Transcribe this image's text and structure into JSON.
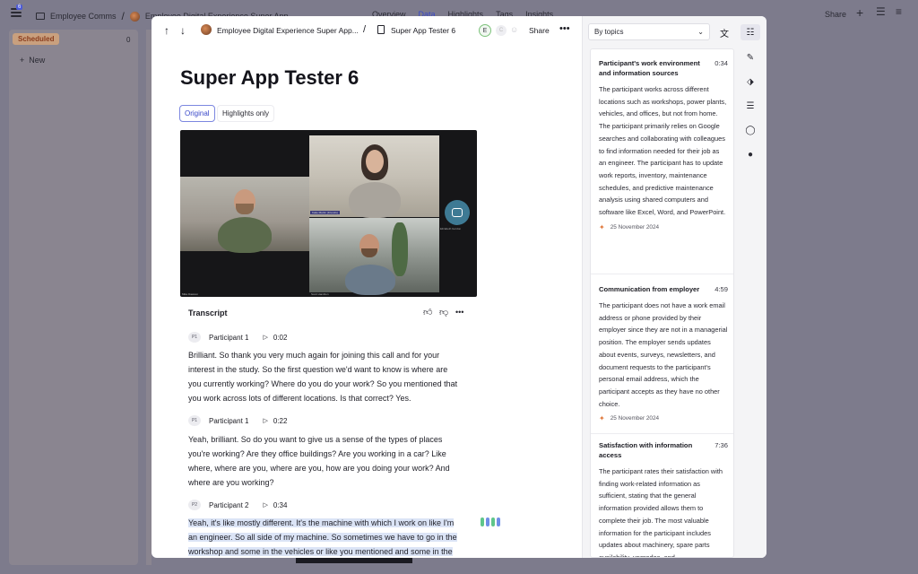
{
  "background": {
    "notification_count": "6",
    "breadcrumb_workspace": "Employee Comms",
    "breadcrumb_project": "Employee Digital Experience Super App",
    "nav": [
      "Overview",
      "Data",
      "Highlights",
      "Tags",
      "Insights"
    ],
    "share_label": "Share",
    "column_label": "Scheduled",
    "column_count": "0",
    "new_label": "New"
  },
  "modal": {
    "breadcrumb_project": "Employee Digital Experience Super App...",
    "breadcrumb_doc": "Super App Tester 6",
    "avatar_initial": "E",
    "avatar_initial_2": "C",
    "share_label": "Share",
    "title": "Super App Tester 6",
    "toggle_original": "Original",
    "toggle_highlights": "Highlights only",
    "transcript_title": "Transcript",
    "video_names": [
      "Mike Dawson",
      "Katie Martin (Friends)",
      "Scott Hamilton",
      "Elizabeth Gordon"
    ],
    "entries": [
      {
        "badge": "P1",
        "speaker": "Participant 1",
        "time": "0:02",
        "lines": [
          "Brilliant. So thank you very much again for joining this call and for your",
          "interest in the study. So the first question we'd want to know is where are",
          "you currently working? Where do you do your work? So you mentioned that",
          "you work across lots of different locations. Is that correct? Yes."
        ]
      },
      {
        "badge": "P1",
        "speaker": "Participant 1",
        "time": "0:22",
        "lines": [
          "Yeah, brilliant. So do you want to give us a sense of the types of places",
          "you're working? Are they office buildings? Are you working in a car? Like",
          "where, where are you, where are you, how are you doing your work? And",
          "where are you working?"
        ]
      },
      {
        "badge": "P2",
        "speaker": "Participant 2",
        "time": "0:34",
        "lines": [
          "Yeah, it's like mostly different. It's the machine with which I work on like I'm",
          "an engineer. So all side of my machine. So sometimes we have to go in the",
          "workshop and some in the vehicles or like you mentioned and some in the"
        ]
      }
    ],
    "highlight_colors": [
      "#5fc58a",
      "#6f8ee6",
      "#5fc58a",
      "#6f8ee6"
    ]
  },
  "side_panel": {
    "select_value": "By topics",
    "topics": [
      {
        "title": "Participant's work environment and information sources",
        "time": "0:34",
        "body": "The participant works across different locations such as workshops, power plants, vehicles, and offices, but not from home. The participant primarily relies on Google searches and collaborating with colleagues to find information needed for their job as an engineer. The participant has to update work reports, inventory, maintenance schedules, and predictive maintenance analysis using shared computers and software like Excel, Word, and PowerPoint.",
        "date": "25 November 2024"
      },
      {
        "title": "Communication from employer",
        "time": "4:59",
        "body": "The participant does not have a work email address or phone provided by their employer since they are not in a managerial position. The employer sends updates about events, surveys, newsletters, and document requests to the participant's personal email address, which the participant accepts as they have no other choice.",
        "date": "25 November 2024"
      },
      {
        "title": "Satisfaction with information access",
        "time": "7:36",
        "body": "The participant rates their satisfaction with finding work-related information as sufficient, stating that the general information provided allows them to complete their job. The most valuable information for the participant includes updates about machinery, spare parts availability, upgrades, and",
        "date": ""
      }
    ]
  }
}
